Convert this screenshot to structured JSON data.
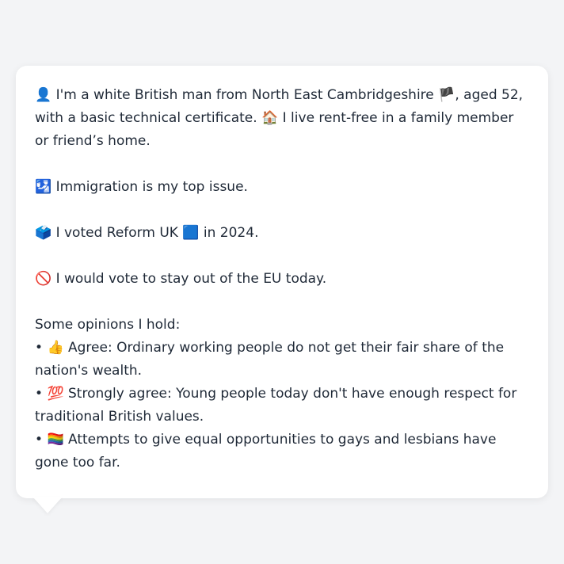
{
  "intro": {
    "person_emoji": "👤",
    "text_a": " I'm a white British man from North East Cambridgeshire ",
    "flag_emoji": "🏴",
    "text_b": ", aged 52, with a basic technical certificate. ",
    "house_emoji": "🏠",
    "text_c": " I live rent-free in a family member or friend’s home."
  },
  "issue": {
    "emoji": "🛂",
    "text": " Immigration is my top issue."
  },
  "vote": {
    "emoji": "🗳️",
    "text_a": " I voted Reform UK ",
    "party_emoji": "🟦",
    "text_b": " in 2024."
  },
  "eu": {
    "emoji": "🚫",
    "text": " I would vote to stay out of the EU today."
  },
  "opinions": {
    "heading": "Some opinions I hold:",
    "items": [
      {
        "bullet": "• ",
        "emoji": "👍",
        "text": " Agree: Ordinary working people do not get their fair share of the nation's wealth."
      },
      {
        "bullet": "• ",
        "emoji": "💯",
        "text": " Strongly agree: Young people today don't have enough respect for traditional British values."
      },
      {
        "bullet": "• ",
        "emoji": "🏳️‍🌈",
        "text": " Attempts to give equal opportunities to gays and lesbians have gone too far."
      }
    ]
  }
}
